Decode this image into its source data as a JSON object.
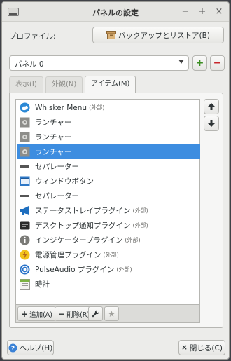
{
  "window": {
    "title": "パネルの設定",
    "minimize": "−",
    "maximize": "+",
    "close": "×"
  },
  "profile": {
    "label": "プロファイル:",
    "button": "バックアップとリストア(B)"
  },
  "panel_select": {
    "value": "パネル 0",
    "add": "+",
    "remove": "−"
  },
  "tabs": [
    {
      "label": "表示(I)"
    },
    {
      "label": "外観(N)"
    },
    {
      "label": "アイテム(M)"
    }
  ],
  "items": [
    {
      "label": "Whisker Menu",
      "suffix": "(外部)",
      "icon": "whisker-icon"
    },
    {
      "label": "ランチャー",
      "suffix": "",
      "icon": "gear-icon"
    },
    {
      "label": "ランチャー",
      "suffix": "",
      "icon": "gear-icon"
    },
    {
      "label": "ランチャー",
      "suffix": "",
      "icon": "gear-icon"
    },
    {
      "label": "セパレーター",
      "suffix": "",
      "icon": "separator-icon"
    },
    {
      "label": "ウィンドウボタン",
      "suffix": "",
      "icon": "window-buttons-icon"
    },
    {
      "label": "セパレーター",
      "suffix": "",
      "icon": "separator-icon"
    },
    {
      "label": "ステータストレイプラグイン",
      "suffix": "(外部)",
      "icon": "megaphone-icon"
    },
    {
      "label": "デスクトップ通知プラグイン",
      "suffix": "(外部)",
      "icon": "notification-icon"
    },
    {
      "label": "インジケータープラグイン",
      "suffix": "(外部)",
      "icon": "info-icon"
    },
    {
      "label": "電源管理プラグイン",
      "suffix": "(外部)",
      "icon": "power-icon"
    },
    {
      "label": "PulseAudio プラグイン",
      "suffix": "(外部)",
      "icon": "audio-icon"
    },
    {
      "label": "時計",
      "suffix": "",
      "icon": "clock-icon"
    }
  ],
  "toolbar": {
    "add": "追加(A)",
    "remove": "削除(R)"
  },
  "footer": {
    "help": "ヘルプ(H)",
    "close": "閉じる(C)"
  },
  "colors": {
    "selection": "#3d8de0",
    "add_green": "#3b8e22",
    "remove_red": "#c7252a"
  }
}
